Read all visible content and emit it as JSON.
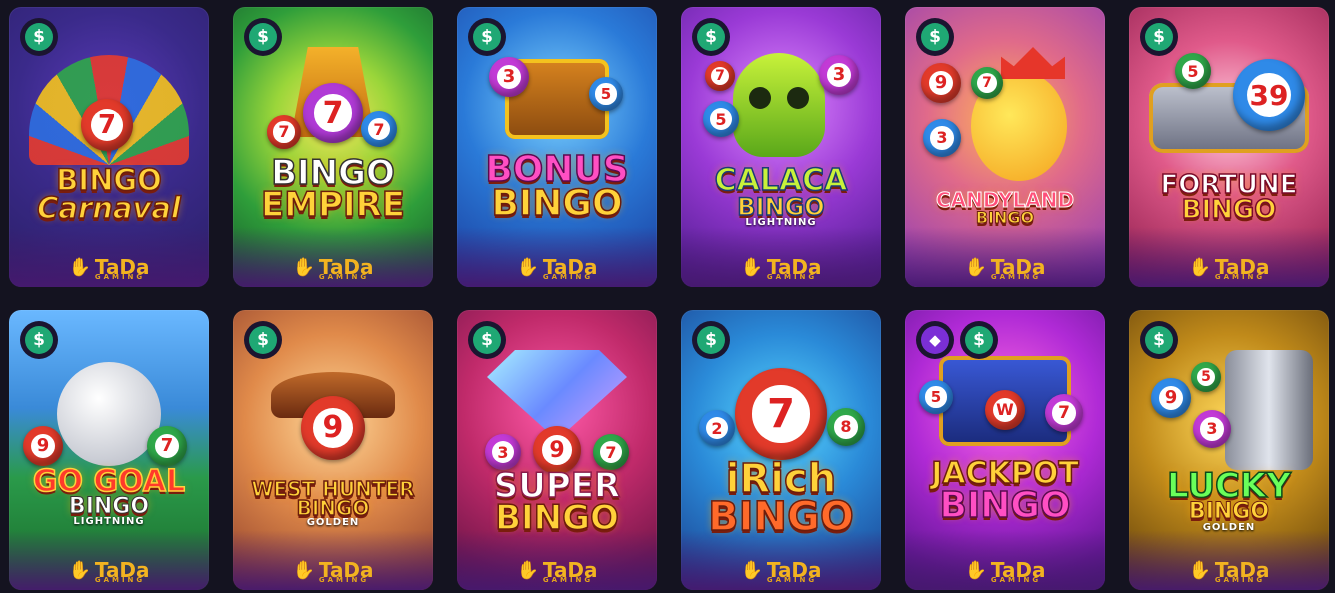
{
  "provider": {
    "name": "TaDa",
    "sub": "GAMING"
  },
  "icons": {
    "money": "dollar-badge-icon",
    "vip": "diamond-badge-icon"
  },
  "badge_glyphs": {
    "money": "$",
    "vip": "◆"
  },
  "colors": {
    "money_badge": "#1fa874",
    "vip_badge": "#7b2fd6",
    "background": "#141320"
  },
  "games": [
    {
      "title": [
        "BINGO",
        "Carnaval"
      ],
      "sub": "",
      "badges": [
        "money"
      ]
    },
    {
      "title": [
        "BINGO",
        "EMPIRE"
      ],
      "sub": "",
      "badges": [
        "money"
      ]
    },
    {
      "title": [
        "BONUS",
        "BINGO"
      ],
      "sub": "",
      "badges": [
        "money"
      ]
    },
    {
      "title": [
        "CALACA",
        "BINGO"
      ],
      "sub": "LIGHTNING",
      "badges": [
        "money"
      ]
    },
    {
      "title": [
        "CANDYLAND",
        "BINGO"
      ],
      "sub": "",
      "badges": [
        "money"
      ]
    },
    {
      "title": [
        "FORTUNE",
        "BINGO"
      ],
      "sub": "",
      "badges": [
        "money"
      ]
    },
    {
      "title": [
        "GO GOAL",
        "BINGO"
      ],
      "sub": "LIGHTNING",
      "badges": [
        "money"
      ]
    },
    {
      "title": [
        "WEST HUNTER",
        "BINGO"
      ],
      "sub": "GOLDEN",
      "badges": [
        "money"
      ]
    },
    {
      "title": [
        "SUPER",
        "BINGO"
      ],
      "sub": "",
      "badges": [
        "money"
      ]
    },
    {
      "title": [
        "iRich",
        "BINGO"
      ],
      "sub": "",
      "badges": [
        "money"
      ]
    },
    {
      "title": [
        "JACKPOT",
        "BINGO"
      ],
      "sub": "",
      "badges": [
        "vip",
        "money"
      ]
    },
    {
      "title": [
        "LUCKY",
        "BINGO"
      ],
      "sub": "GOLDEN",
      "badges": [
        "money"
      ]
    }
  ]
}
